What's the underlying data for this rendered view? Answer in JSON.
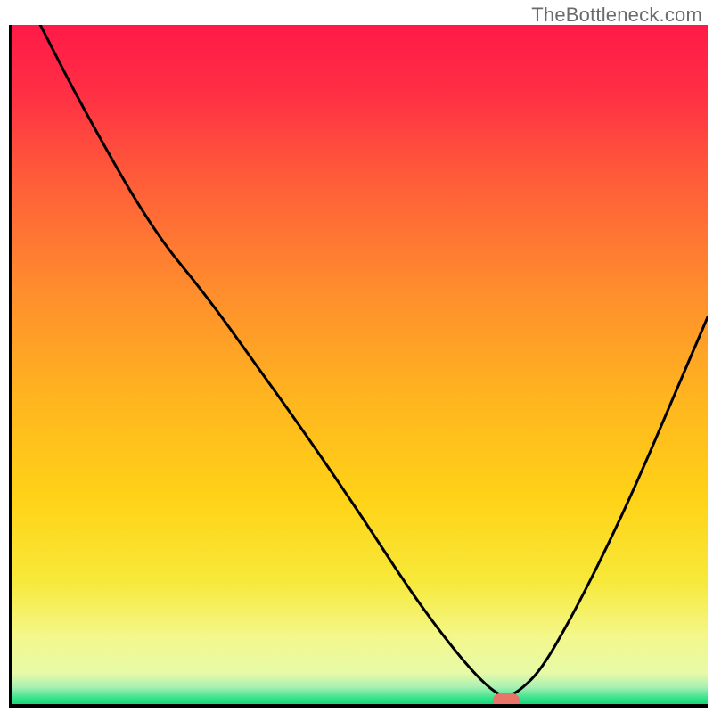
{
  "watermark": "TheBottleneck.com",
  "chart_data": {
    "type": "line",
    "title": "",
    "xlabel": "",
    "ylabel": "",
    "xlim": [
      0,
      100
    ],
    "ylim": [
      0,
      100
    ],
    "x": [
      4,
      10,
      20,
      28,
      35,
      42,
      50,
      57,
      62,
      66,
      69,
      71,
      73,
      76,
      80,
      85,
      90,
      95,
      100
    ],
    "y": [
      100,
      88,
      70,
      60,
      50,
      40,
      28,
      17,
      10,
      5,
      2,
      1,
      2,
      5,
      12,
      22,
      33,
      45,
      57
    ],
    "marker": {
      "x": 71,
      "y": 0.5
    },
    "gradient_stops": [
      {
        "offset": 0.0,
        "color": "#ff1a47"
      },
      {
        "offset": 0.1,
        "color": "#ff2f44"
      },
      {
        "offset": 0.22,
        "color": "#ff5a3a"
      },
      {
        "offset": 0.38,
        "color": "#ff8a2e"
      },
      {
        "offset": 0.55,
        "color": "#ffb51f"
      },
      {
        "offset": 0.7,
        "color": "#ffd317"
      },
      {
        "offset": 0.82,
        "color": "#f7e93a"
      },
      {
        "offset": 0.9,
        "color": "#f4f78a"
      },
      {
        "offset": 0.955,
        "color": "#e6faa8"
      },
      {
        "offset": 0.975,
        "color": "#a8f0b2"
      },
      {
        "offset": 0.99,
        "color": "#3fe48f"
      },
      {
        "offset": 1.0,
        "color": "#17d879"
      }
    ]
  }
}
